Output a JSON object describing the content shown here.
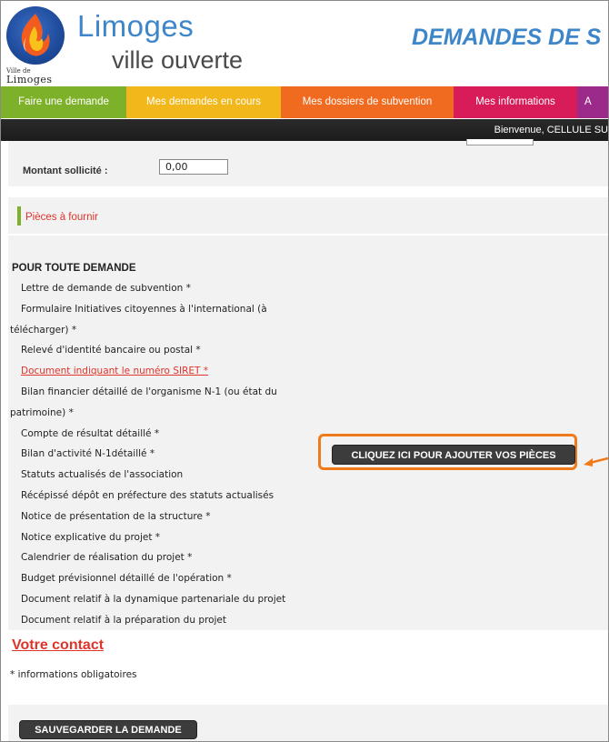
{
  "header": {
    "logo": {
      "ville_label": "Ville de",
      "city_label": "Limoges"
    },
    "brand_title": "Limoges",
    "brand_subtitle": "ville ouverte",
    "app_title": "DEMANDES DE S"
  },
  "menu": {
    "items": [
      {
        "label": "Faire une demande",
        "color": "#7eb12a"
      },
      {
        "label": "Mes demandes en cours",
        "color": "#f2b71a"
      },
      {
        "label": "Mes dossiers de subvention",
        "color": "#f06a1f"
      },
      {
        "label": "Mes informations",
        "color": "#d81c5a"
      },
      {
        "label": "A",
        "color": "#9c2a8a"
      }
    ]
  },
  "welcome": {
    "text": "Bienvenue, CELLULE SU"
  },
  "amount": {
    "label": "Montant sollicité :",
    "value": "0,00"
  },
  "pieces": {
    "title": "Pièces à fournir",
    "section_heading": "POUR TOUTE DEMANDE",
    "documents": [
      {
        "text": "Lettre de demande de subvention *"
      },
      {
        "text": "Formulaire Initiatives citoyennes à l'international (à"
      },
      {
        "text": "télécharger) *"
      },
      {
        "text": "Relevé d'identité bancaire ou postal *"
      },
      {
        "text": "Document indiquant le numéro SIRET *"
      },
      {
        "text": "Bilan financier détaillé de l'organisme N-1 (ou état du"
      },
      {
        "text": "patrimoine) *"
      },
      {
        "text": "Compte de résultat détaillé *"
      },
      {
        "text": "Bilan d'activité N-1détaillé *"
      },
      {
        "text": "Statuts actualisés de l'association"
      },
      {
        "text": "Récépissé dépôt en préfecture des statuts actualisés"
      },
      {
        "text": "Notice de présentation de la structure *"
      },
      {
        "text": "Notice explicative du projet *"
      },
      {
        "text": "Calendrier de réalisation du projet *"
      },
      {
        "text": "Budget prévisionnel détaillé de l'opération *"
      },
      {
        "text": "Document relatif à la dynamique partenariale du projet"
      },
      {
        "text": "Document relatif à la préparation du projet"
      }
    ],
    "add_button_label": "CLIQUEZ ICI POUR AJOUTER VOS PIÈCES"
  },
  "contact": {
    "heading": "Votre contact"
  },
  "required_note": "* informations obligatoires",
  "save_button_label": "SAUVEGARDER LA DEMANDE",
  "colors": {
    "accent_blue": "#3d86c9",
    "link_red": "#e0332a",
    "highlight_orange": "#f07a1a",
    "button_dark": "#3c3c3c"
  }
}
